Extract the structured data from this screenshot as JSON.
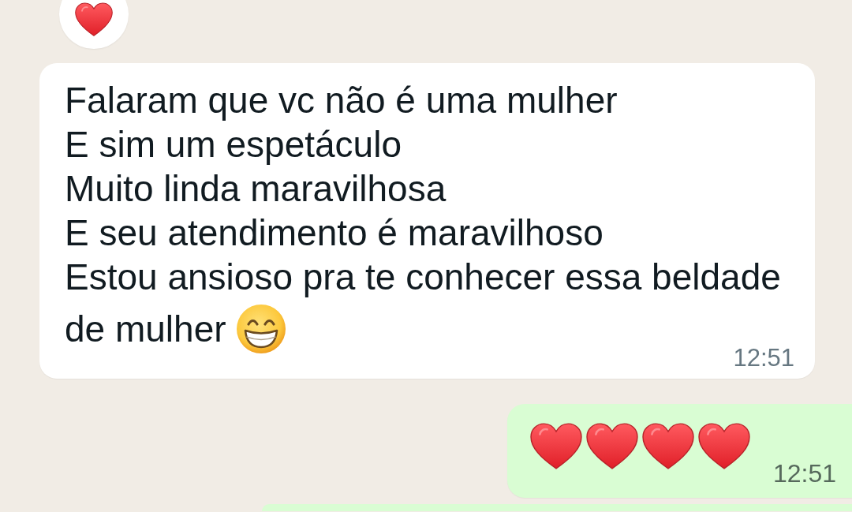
{
  "chat": {
    "messages": [
      {
        "kind": "reaction"
      },
      {
        "outgoing": false,
        "kind": "text",
        "lines": [
          "Falaram que vc não é uma mulher",
          "E sim um espetáculo",
          "Muito linda maravilhosa",
          "E seu atendimento é maravilhoso",
          "Estou ansioso pra te conhecer essa beldade",
          "de mulher"
        ],
        "ends_with_emoji": true,
        "time": "12:51"
      },
      {
        "outgoing": true,
        "kind": "emoji",
        "time": "12:51"
      },
      {
        "outgoing": true,
        "kind": "partial"
      }
    ]
  }
}
